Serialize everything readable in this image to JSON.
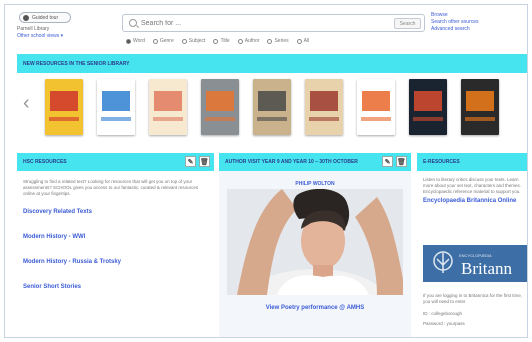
{
  "header": {
    "login_label": "Guided tour",
    "school_library": "Parnell Library",
    "other_school": "Other school views ▾",
    "search_placeholder": "Search for ...",
    "search_button": "Search",
    "links": [
      "Browse",
      "Search other sources",
      "Advanced search"
    ],
    "filters": [
      "Word",
      "Genre",
      "Subject",
      "Title",
      "Author",
      "Series",
      "All"
    ],
    "selected_filter": "Word"
  },
  "new_resources": {
    "title": "NEW RESOURCES IN THE SENIOR LIBRARY",
    "books": [
      {
        "color": "#f2c230",
        "accent": "#d0342c"
      },
      {
        "color": "#ffffff",
        "accent": "#2f7fd1"
      },
      {
        "color": "#f6e9d0",
        "accent": "#e07a5f"
      },
      {
        "color": "#8a8f93",
        "accent": "#e8742f"
      },
      {
        "color": "#c9b28c",
        "accent": "#4a4a4a"
      },
      {
        "color": "#e7d2ac",
        "accent": "#9c3b2f"
      },
      {
        "color": "#ffffff",
        "accent": "#e8672a"
      },
      {
        "color": "#1a2430",
        "accent": "#d84b2e"
      },
      {
        "color": "#2a2a2a",
        "accent": "#f07c1a"
      }
    ]
  },
  "panels": {
    "hsc": {
      "title": "HSC RESOURCES",
      "intro": "Struggling to find a related text? Looking for resources that will get you on top of your assessments? SCHOOL gives you access to our fantastic, curated & relevant resources online at your fingertips.",
      "links": [
        "Discovery Related Texts",
        "Modern History - WWI",
        "Modern History - Russia & Trotsky",
        "Senior Short Stories"
      ]
    },
    "author": {
      "title": "AUTHOR VISIT YEAR 9 AND YEAR 10 – 30TH OCTOBER",
      "name": "PHILIP WOLTON",
      "caption": "View Poetry performance @ AMHS"
    },
    "eres": {
      "title": "E-RESOURCES",
      "intro": "Listen to literary critics discuss your texts. Learn more about your set text, characters and themes. Encyclopaedic reference material to support you.",
      "link": "Encyclopaedia Britannica Online",
      "logo_text": "Britann",
      "note": "If you are logging in to Britannica for the first time, you will need to enter",
      "id_label": "ID : collegeborough",
      "password_label": "Password : yourpass"
    }
  },
  "colors": {
    "banner": "#46e4ee",
    "link": "#3b5bd6"
  }
}
